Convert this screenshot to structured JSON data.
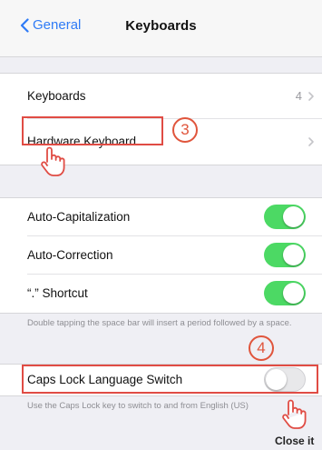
{
  "nav": {
    "back_label": "General",
    "title": "Keyboards"
  },
  "group1": {
    "keyboards": {
      "label": "Keyboards",
      "value": "4"
    },
    "hardware": {
      "label": "Hardware Keyboard"
    }
  },
  "group2": {
    "auto_cap": {
      "label": "Auto-Capitalization",
      "on": true
    },
    "auto_correct": {
      "label": "Auto-Correction",
      "on": true
    },
    "shortcut": {
      "label": "“.” Shortcut",
      "on": true
    },
    "footer": "Double tapping the space bar will insert a period followed by a space."
  },
  "group3": {
    "caps_lock": {
      "label": "Caps Lock Language Switch",
      "on": false
    },
    "footer": "Use the Caps Lock key to switch to and from English (US)"
  },
  "annotations": {
    "step3": "3",
    "step4": "4",
    "close_label": "Close it"
  },
  "colors": {
    "accent": "#2f7bf6",
    "toggle_on": "#4cd964",
    "annotation": "#e04c44"
  },
  "icons": {
    "back": "chevron-left-icon",
    "row": "chevron-right-icon",
    "pointer": "hand-pointer-icon"
  }
}
